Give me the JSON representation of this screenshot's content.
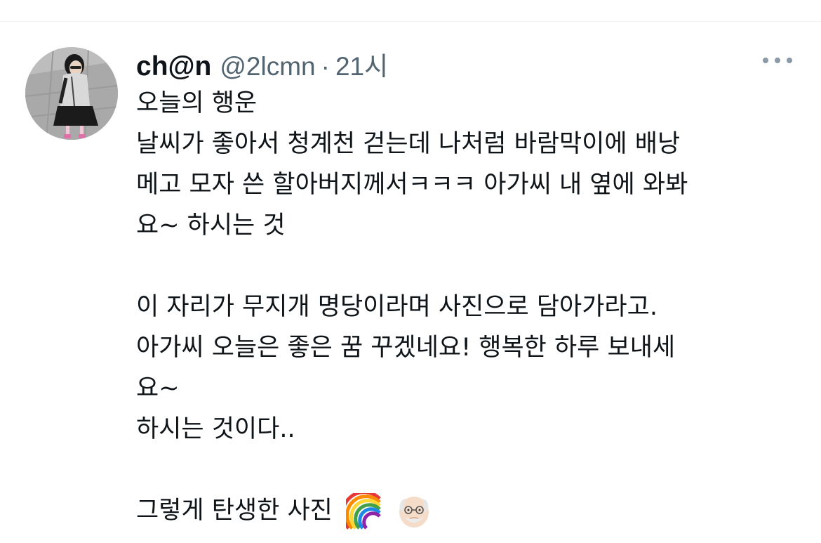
{
  "tweet": {
    "display_name": "ch@n",
    "handle": "@2lcmn",
    "separator": "·",
    "time": "21시",
    "more_icon": "more-horizontal-icon",
    "lines": [
      "오늘의 행운",
      "날씨가 좋아서 청계천 걷는데 나처럼 바람막이에 배낭",
      "메고 모자 쓴 할아버지께서ㅋㅋㅋ 아가씨 내 옆에 와봐",
      "요~ 하시는 것",
      "",
      "이 자리가 무지개 명당이라며 사진으로 담아가라고.",
      "아가씨 오늘은 좋은 꿈 꾸겠네요! 행복한 하루 보내세",
      "요~",
      "하시는 것이다..",
      "",
      "그렇게 탄생한 사진"
    ],
    "trailing_emojis": [
      "rainbow-emoji",
      "old-man-emoji"
    ]
  },
  "colors": {
    "text_primary": "#0f1419",
    "text_secondary": "#536471",
    "divider": "#eff3f4"
  }
}
